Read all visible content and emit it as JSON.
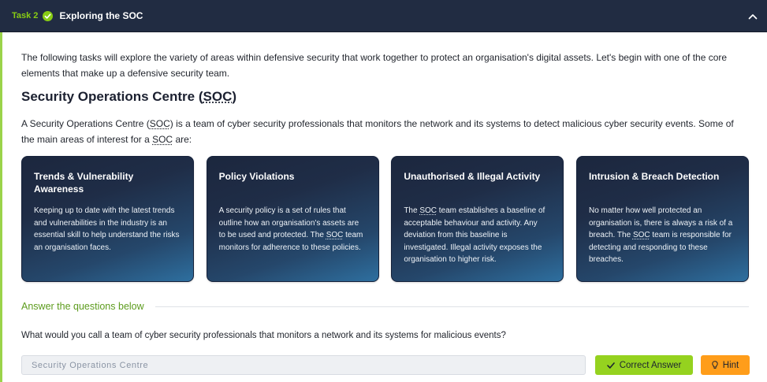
{
  "header": {
    "task_label": "Task 2",
    "title": "Exploring the SOC"
  },
  "intro": "The following tasks will explore the variety of areas within defensive security that work together to protect an organisation's digital assets. Let's begin with one of the core elements that make up a defensive security team.",
  "heading": {
    "before": "Security Operations Centre (",
    "abbr": "SOC",
    "after": ")"
  },
  "soc_paragraph": {
    "part1": "A Security Operations Centre (",
    "abbr1": "SOC",
    "part2": ") is a team of cyber security professionals that monitors the network and its systems to detect malicious cyber security events. Some of the main areas of interest for a ",
    "abbr2": "SOC",
    "part3": " are:"
  },
  "cards": [
    {
      "title": "Trends & Vulnerability Awareness",
      "body_before": "Keeping up to date with the latest trends and vulnerabilities in the industry is an essential skill to help understand the risks an organisation faces."
    },
    {
      "title": "Policy Violations",
      "body_before": "A security policy is a set of rules that outline how an organisation's assets are to be used and protected. The ",
      "abbr": "SOC",
      "body_after": " team monitors for adherence to these policies."
    },
    {
      "title": "Unauthorised & Illegal Activity",
      "body_before": "The ",
      "abbr": "SOC",
      "body_after": " team establishes a baseline of acceptable behaviour and activity. Any deviation from this baseline is investigated. Illegal activity exposes the organisation to higher risk."
    },
    {
      "title": "Intrusion & Breach Detection",
      "body_before": "No matter how well protected an organisation is, there is always a risk of a breach. The ",
      "abbr": "SOC",
      "body_after": " team is responsible for detecting and responding to these breaches."
    }
  ],
  "questions_section": {
    "label": "Answer the questions below"
  },
  "question": {
    "text": "What would you call a team of cyber security professionals that monitors a network and its systems for malicious events?",
    "answer_value": "Security Operations Centre",
    "correct_label": "Correct Answer",
    "hint_label": "Hint"
  },
  "icons": {
    "task_status": "check-circle-icon",
    "collapse": "chevron-up-icon",
    "correct": "check-icon",
    "hint": "lightbulb-icon"
  },
  "colors": {
    "accent": "#88cc14",
    "header_bg": "#212c42",
    "correct_button": "#95d21f",
    "hint_button": "#ff9d1a",
    "section_label": "#5d9c1e"
  }
}
